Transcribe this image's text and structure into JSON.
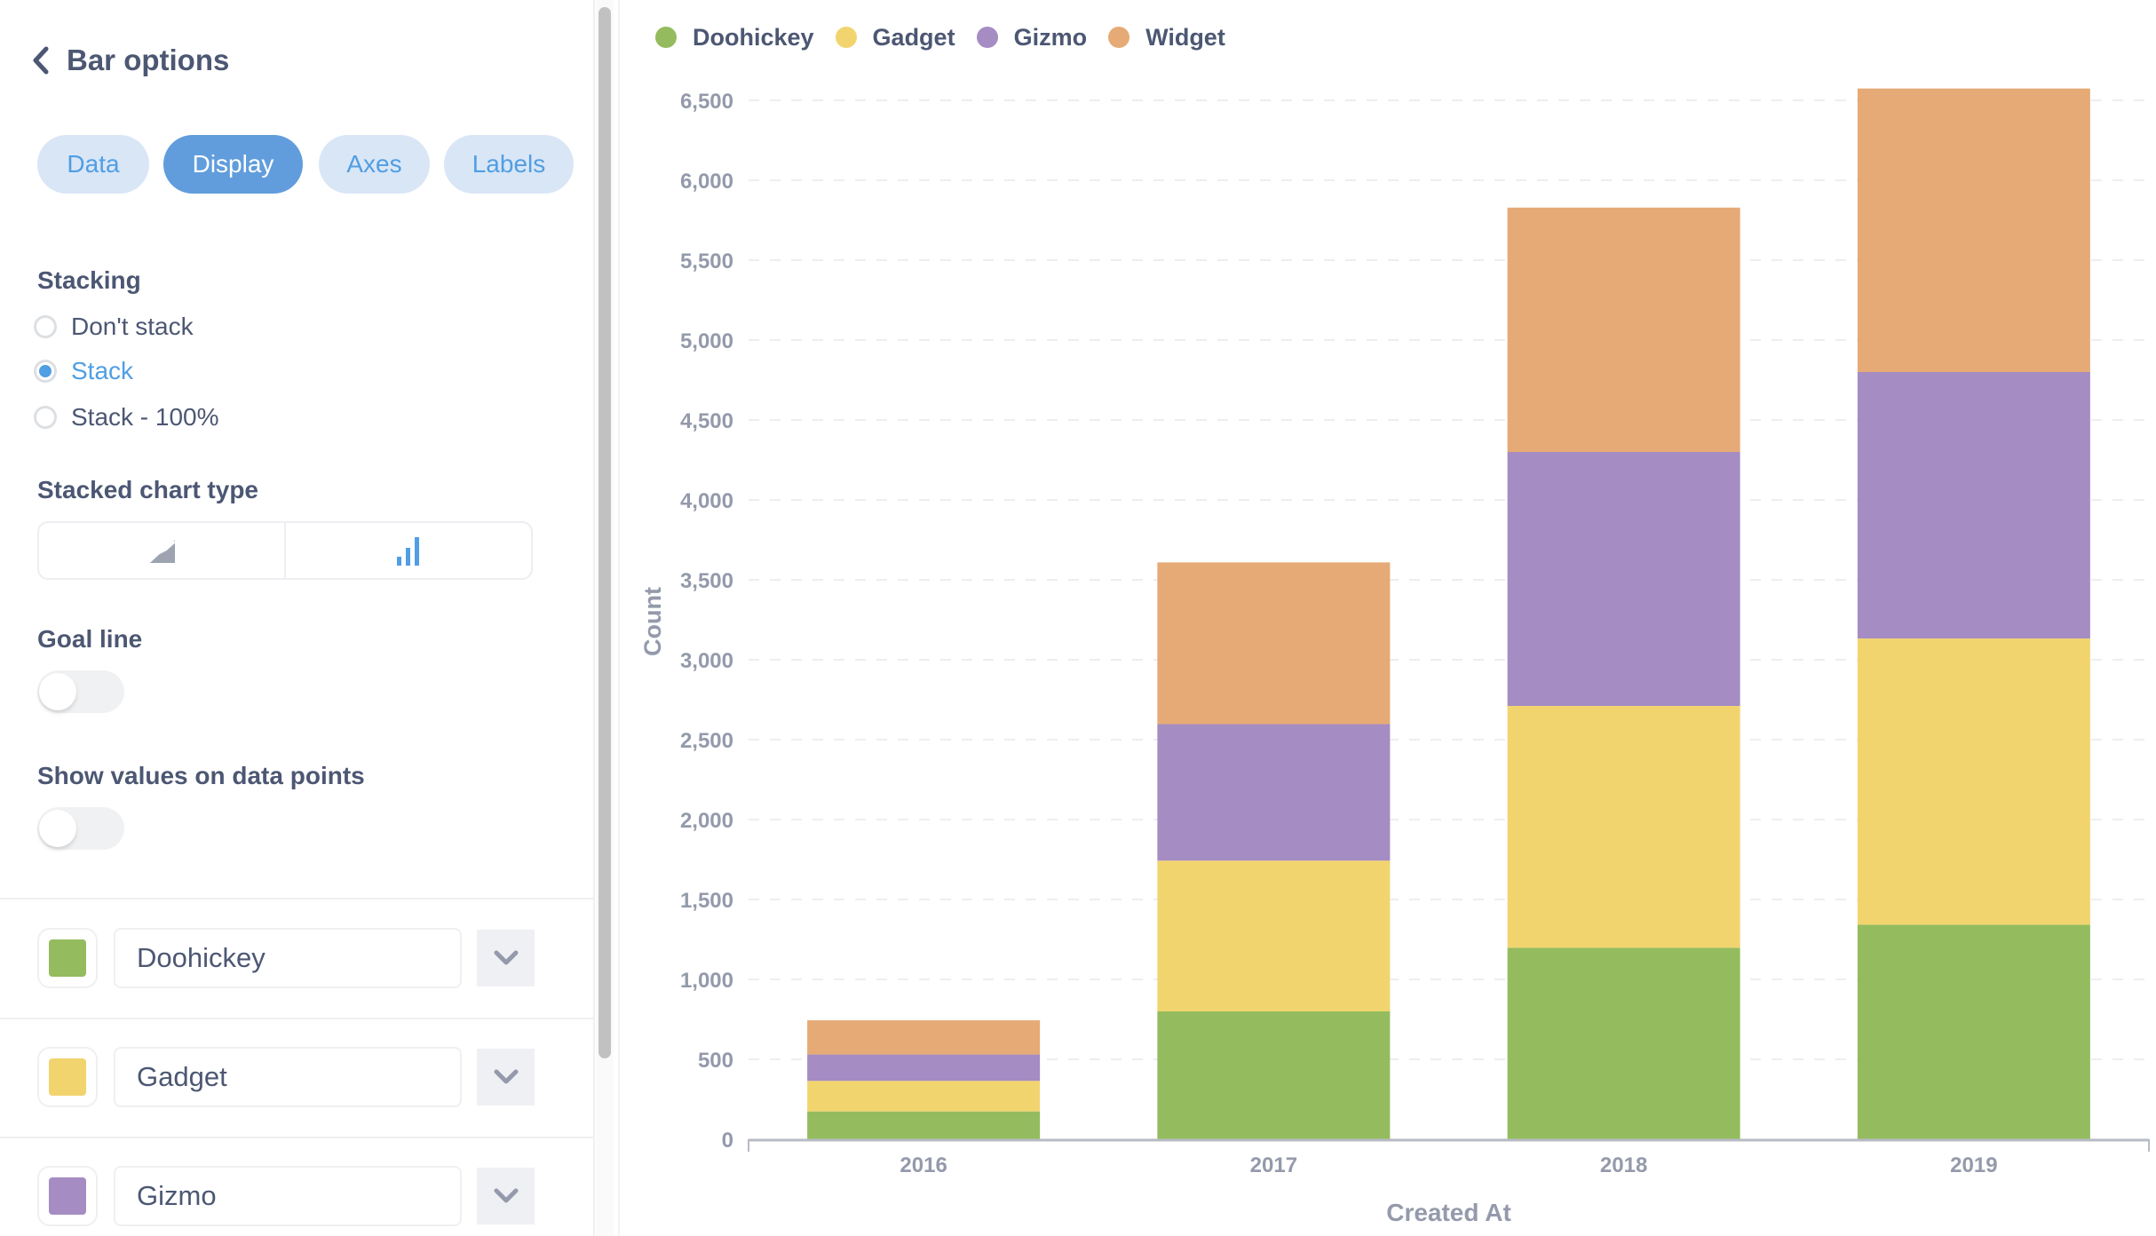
{
  "sidebar": {
    "title": "Bar options",
    "tabs": [
      {
        "label": "Data",
        "active": false
      },
      {
        "label": "Display",
        "active": true
      },
      {
        "label": "Axes",
        "active": false
      },
      {
        "label": "Labels",
        "active": false
      }
    ],
    "stacking": {
      "label": "Stacking",
      "options": [
        {
          "label": "Don't stack",
          "selected": false
        },
        {
          "label": "Stack",
          "selected": true
        },
        {
          "label": "Stack - 100%",
          "selected": false
        }
      ]
    },
    "stacked_chart_type": {
      "label": "Stacked chart type",
      "options": [
        {
          "icon": "area-chart-icon",
          "selected": false
        },
        {
          "icon": "bar-chart-icon",
          "selected": true
        }
      ]
    },
    "goal_line": {
      "label": "Goal line",
      "enabled": false
    },
    "show_values": {
      "label": "Show values on data points",
      "enabled": false
    },
    "series": [
      {
        "name": "Doohickey",
        "color": "#94bc5e"
      },
      {
        "name": "Gadget",
        "color": "#f2d46f"
      },
      {
        "name": "Gizmo",
        "color": "#a58cc2"
      }
    ]
  },
  "colors": {
    "accent": "#509ee3",
    "tab_active_bg": "#619ddc",
    "tab_inactive_bg": "#d9e6f6",
    "text": "#4c5773",
    "axis_text": "#949aab"
  },
  "chart_data": {
    "type": "bar",
    "stacked": true,
    "title": "",
    "xlabel": "Created At",
    "ylabel": "Count",
    "categories": [
      "2016",
      "2017",
      "2018",
      "2019"
    ],
    "ylim": [
      0,
      6500
    ],
    "yticks": [
      0,
      500,
      1000,
      1500,
      2000,
      2500,
      3000,
      3500,
      4000,
      4500,
      5000,
      5500,
      6000,
      6500
    ],
    "ytick_labels": [
      "0",
      "500",
      "1,000",
      "1,500",
      "2,000",
      "2,500",
      "3,000",
      "3,500",
      "4,000",
      "4,500",
      "5,000",
      "5,500",
      "6,000",
      "6,500"
    ],
    "grid": true,
    "legend_position": "top-left",
    "series": [
      {
        "name": "Doohickey",
        "color": "#94bc5e",
        "values": [
          174,
          800,
          1198,
          1342
        ]
      },
      {
        "name": "Gadget",
        "color": "#f2d46f",
        "values": [
          191,
          943,
          1513,
          1791
        ]
      },
      {
        "name": "Gizmo",
        "color": "#a58cc2",
        "values": [
          165,
          854,
          1589,
          1667
        ]
      },
      {
        "name": "Widget",
        "color": "#e6aa76",
        "values": [
          214,
          1012,
          1529,
          1774
        ]
      }
    ]
  }
}
